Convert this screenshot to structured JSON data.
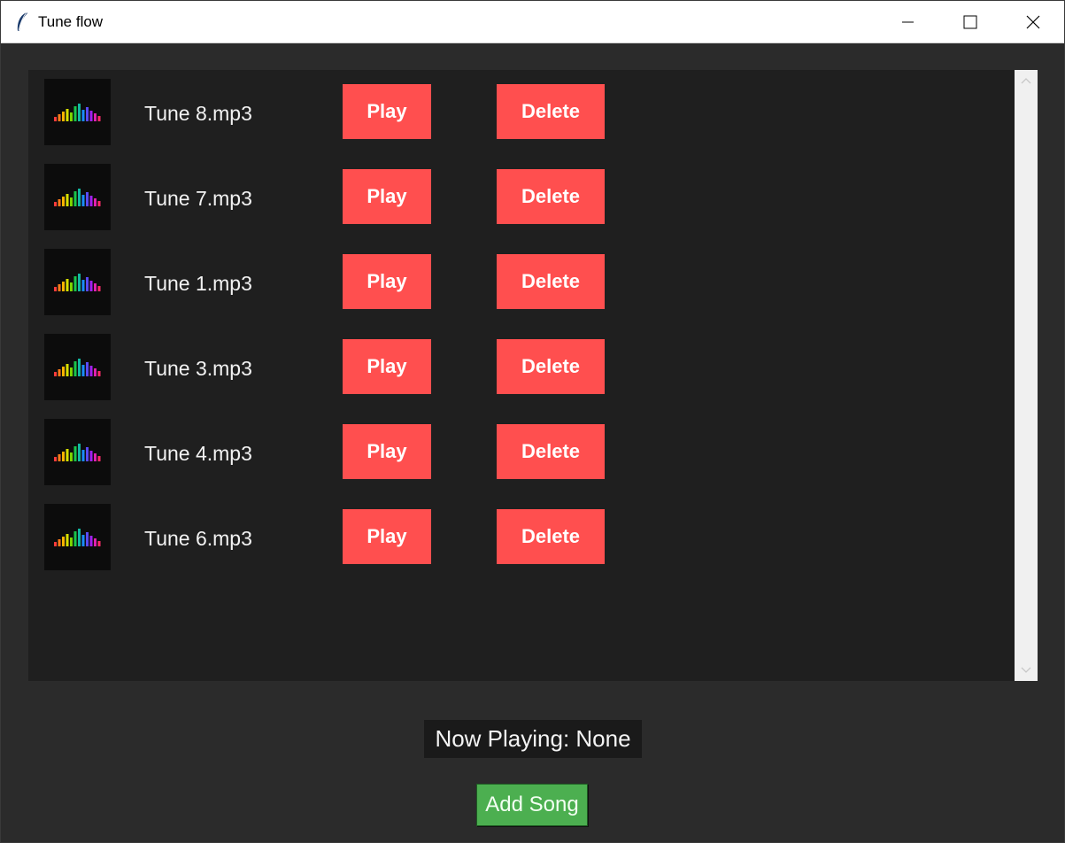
{
  "window": {
    "title": "Tune flow",
    "app_icon": "feather-icon",
    "controls": [
      "minimize-icon",
      "maximize-icon",
      "close-icon"
    ]
  },
  "songs": [
    {
      "name": "Tune 8.mp3",
      "play_label": "Play",
      "delete_label": "Delete"
    },
    {
      "name": "Tune 7.mp3",
      "play_label": "Play",
      "delete_label": "Delete"
    },
    {
      "name": "Tune 1.mp3",
      "play_label": "Play",
      "delete_label": "Delete"
    },
    {
      "name": "Tune 3.mp3",
      "play_label": "Play",
      "delete_label": "Delete"
    },
    {
      "name": "Tune 4.mp3",
      "play_label": "Play",
      "delete_label": "Delete"
    },
    {
      "name": "Tune 6.mp3",
      "play_label": "Play",
      "delete_label": "Delete"
    }
  ],
  "status": {
    "now_playing": "Now Playing: None"
  },
  "actions": {
    "add_song_label": "Add Song"
  },
  "colors": {
    "background": "#2b2b2b",
    "list_background": "#1f1f1f",
    "button_red": "#ff4f4f",
    "button_green": "#4caf50"
  }
}
